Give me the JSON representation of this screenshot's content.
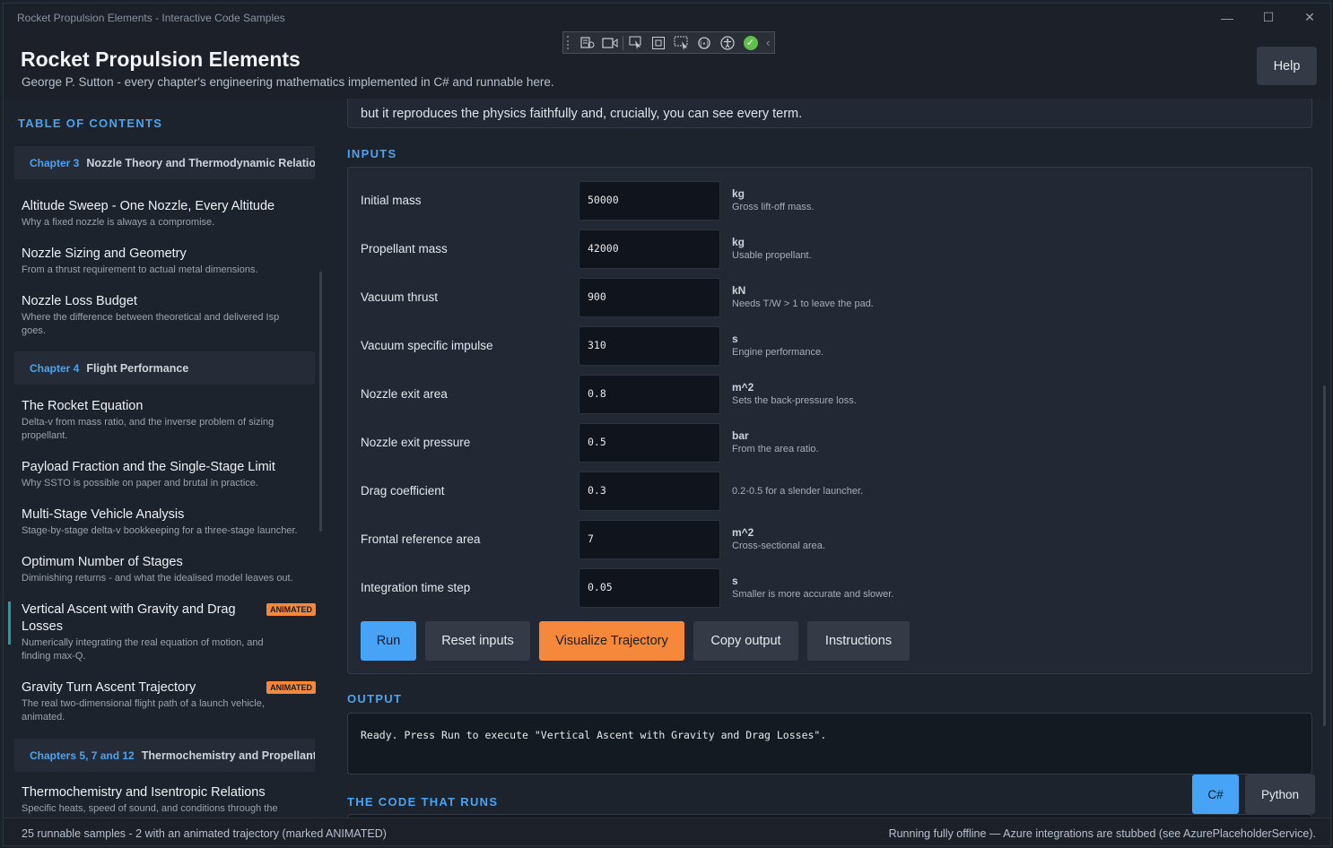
{
  "window": {
    "title": "Rocket Propulsion Elements - Interactive Code Samples",
    "minimize": "—",
    "maximize": "☐",
    "close": "✕"
  },
  "header": {
    "title": "Rocket Propulsion Elements",
    "subtitle": "George P. Sutton - every chapter's engineering mathematics implemented in C# and runnable here.",
    "help_label": "Help"
  },
  "sidebar": {
    "heading": "TABLE OF CONTENTS",
    "chapters": [
      {
        "num": "Chapter 3",
        "title": "Nozzle Theory and Thermodynamic Relations"
      },
      {
        "num": "Chapter 4",
        "title": "Flight Performance"
      },
      {
        "num": "Chapters 5, 7 and 12",
        "title": "Thermochemistry and Propellants"
      }
    ],
    "items": [
      {
        "title": "Altitude Sweep - One Nozzle, Every Altitude",
        "desc": "Why a fixed nozzle is always a compromise."
      },
      {
        "title": "Nozzle Sizing and Geometry",
        "desc": "From a thrust requirement to actual metal dimensions."
      },
      {
        "title": "Nozzle Loss Budget",
        "desc": "Where the difference between theoretical and delivered Isp goes."
      },
      {
        "title": "The Rocket Equation",
        "desc": "Delta-v from mass ratio, and the inverse problem of sizing propellant."
      },
      {
        "title": "Payload Fraction and the Single-Stage Limit",
        "desc": "Why SSTO is possible on paper and brutal in practice."
      },
      {
        "title": "Multi-Stage Vehicle Analysis",
        "desc": "Stage-by-stage delta-v bookkeeping for a three-stage launcher."
      },
      {
        "title": "Optimum Number of Stages",
        "desc": "Diminishing returns - and what the idealised model leaves out."
      },
      {
        "title": "Vertical Ascent with Gravity and Drag Losses",
        "desc": "Numerically integrating the real equation of motion, and finding max-Q.",
        "badge": "ANIMATED"
      },
      {
        "title": "Gravity Turn Ascent Trajectory",
        "desc": "The real two-dimensional flight path of a launch vehicle, animated.",
        "badge": "ANIMATED"
      },
      {
        "title": "Thermochemistry and Isentropic Relations",
        "desc": "Specific heats, speed of sound, and conditions through the nozzle."
      }
    ]
  },
  "main": {
    "intro_tail": "but it reproduces the physics faithfully and, crucially, you can see every term.",
    "inputs_heading": "INPUTS",
    "inputs": [
      {
        "label": "Initial mass",
        "value": "50000",
        "unit": "kg",
        "hint": "Gross lift-off mass."
      },
      {
        "label": "Propellant mass",
        "value": "42000",
        "unit": "kg",
        "hint": "Usable propellant."
      },
      {
        "label": "Vacuum thrust",
        "value": "900",
        "unit": "kN",
        "hint": "Needs T/W > 1 to leave the pad."
      },
      {
        "label": "Vacuum specific impulse",
        "value": "310",
        "unit": "s",
        "hint": "Engine performance."
      },
      {
        "label": "Nozzle exit area",
        "value": "0.8",
        "unit": "m^2",
        "hint": "Sets the back-pressure loss."
      },
      {
        "label": "Nozzle exit pressure",
        "value": "0.5",
        "unit": "bar",
        "hint": "From the area ratio."
      },
      {
        "label": "Drag coefficient",
        "value": "0.3",
        "unit": "",
        "hint": "0.2-0.5 for a slender launcher."
      },
      {
        "label": "Frontal reference area",
        "value": "7",
        "unit": "m^2",
        "hint": "Cross-sectional area."
      },
      {
        "label": "Integration time step",
        "value": "0.05",
        "unit": "s",
        "hint": "Smaller is more accurate and slower."
      }
    ],
    "buttons": {
      "run": "Run",
      "reset": "Reset inputs",
      "visualize": "Visualize Trajectory",
      "copy": "Copy output",
      "instructions": "Instructions"
    },
    "output_heading": "OUTPUT",
    "output_text": "Ready. Press Run to execute \"Vertical Ascent with Gravity and Drag Losses\".",
    "code_heading": "THE CODE THAT RUNS",
    "lang_cs": "C#",
    "lang_py": "Python"
  },
  "status": {
    "left": "25 runnable samples  -  2 with an animated trajectory (marked ANIMATED)",
    "right": "Running fully offline — Azure integrations are stubbed (see AzurePlaceholderService)."
  },
  "colors": {
    "accent": "#4aa3f0",
    "run_button": "#46a3f5",
    "visualize_button": "#f5883a",
    "badge": "#f5883a",
    "active_marker": "#0ea5a8"
  }
}
